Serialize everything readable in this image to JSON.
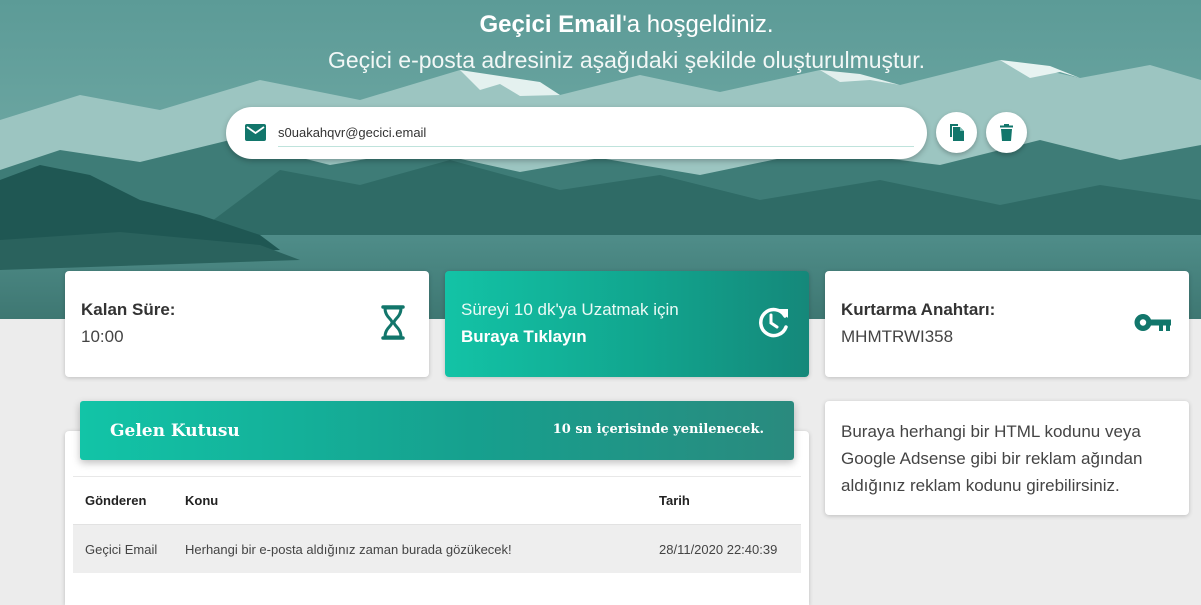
{
  "hero": {
    "title_bold": "Geçici Email",
    "title_rest": "'a hoşgeldiniz.",
    "subtitle": "Geçici e-posta adresiniz aşağıdaki şekilde oluşturulmuştur."
  },
  "email": {
    "value": "s0uakahqvr@gecici.email",
    "icon": "mail-icon",
    "copy_icon": "copy-icon",
    "delete_icon": "trash-icon"
  },
  "timer": {
    "label": "Kalan Süre:",
    "value": "10:00",
    "icon": "hourglass-icon"
  },
  "extend": {
    "line1": "Süreyi 10 dk'ya Uzatmak için",
    "line2": "Buraya Tıklayın",
    "icon": "history-refresh-icon"
  },
  "recovery": {
    "label": "Kurtarma Anahtarı:",
    "value": "MHMTRWI358",
    "icon": "key-icon"
  },
  "inbox": {
    "title": "Gelen Kutusu",
    "refresh_text": "10 sn içerisinde yenilenecek.",
    "columns": [
      "Gönderen",
      "Konu",
      "Tarih"
    ],
    "rows": [
      {
        "sender": "Geçici Email",
        "subject": "Herhangi bir e-posta aldığınız zaman burada gözükecek!",
        "date": "28/11/2020 22:40:39"
      }
    ]
  },
  "ad": {
    "text": "Buraya herhangi bir HTML kodunu veya Google Adsense gibi bir reklam ağından aldığınız reklam kodunu girebilirsiniz."
  },
  "colors": {
    "accent": "#14a58f",
    "accent_light": "#13c3a6",
    "icon": "#12766b",
    "background": "#ececec"
  }
}
